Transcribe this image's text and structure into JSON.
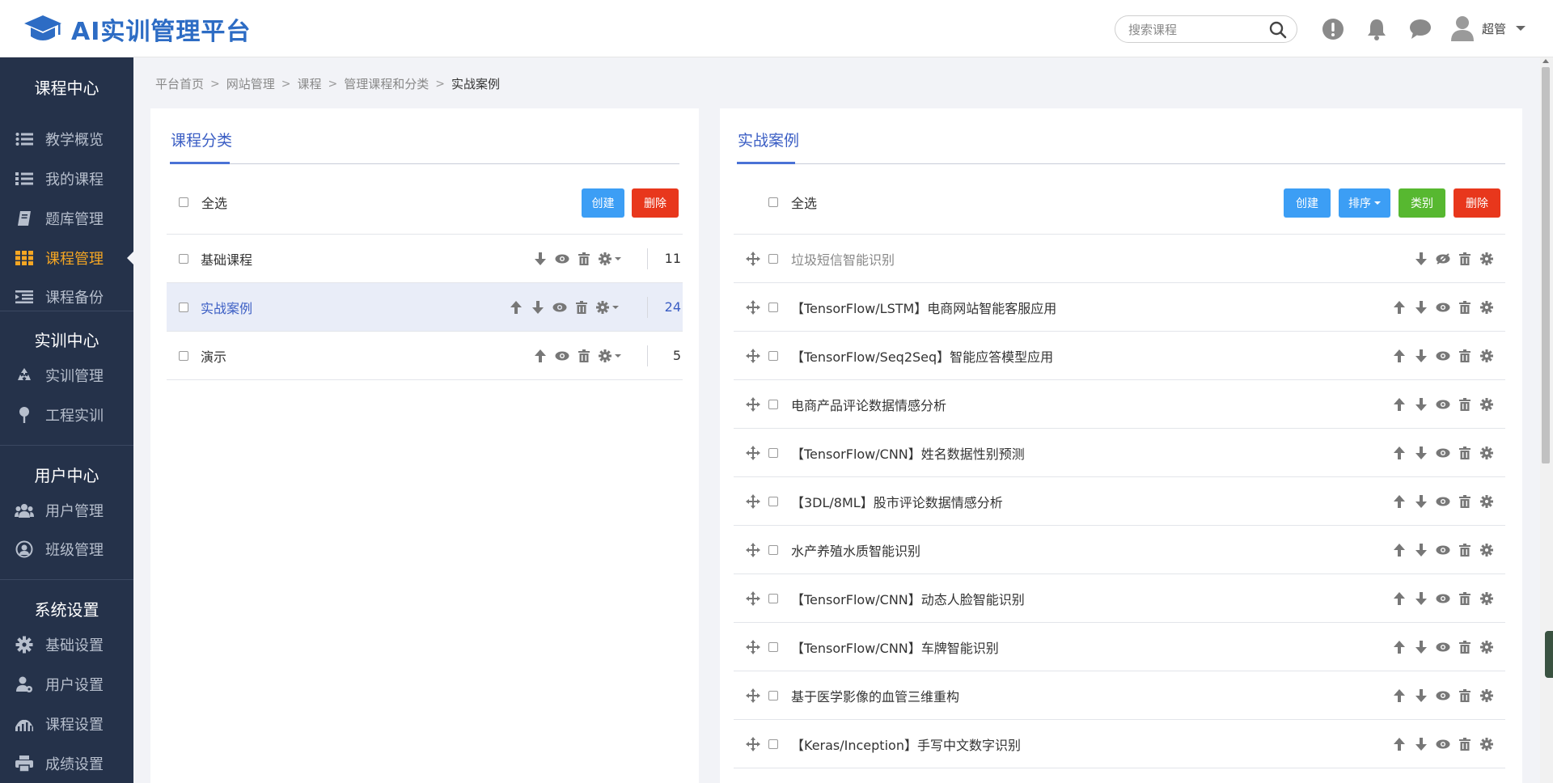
{
  "app": {
    "title": "AI实训管理平台"
  },
  "header": {
    "search_placeholder": "搜索课程",
    "user_name": "超管"
  },
  "sidebar": {
    "sections": [
      {
        "title": "课程中心",
        "items": [
          {
            "label": "教学概览",
            "icon": "list-icon"
          },
          {
            "label": "我的课程",
            "icon": "numbered-list-icon"
          },
          {
            "label": "题库管理",
            "icon": "book-icon"
          },
          {
            "label": "课程管理",
            "icon": "grid-icon",
            "active": true
          },
          {
            "label": "课程备份",
            "icon": "indent-icon"
          }
        ]
      },
      {
        "title": "实训中心",
        "items": [
          {
            "label": "实训管理",
            "icon": "recycle-icon"
          },
          {
            "label": "工程实训",
            "icon": "pin-icon"
          }
        ]
      },
      {
        "title": "用户中心",
        "items": [
          {
            "label": "用户管理",
            "icon": "users-icon"
          },
          {
            "label": "班级管理",
            "icon": "user-circle-icon"
          }
        ]
      },
      {
        "title": "系统设置",
        "items": [
          {
            "label": "基础设置",
            "icon": "gear-icon"
          },
          {
            "label": "用户设置",
            "icon": "user-gear-icon"
          },
          {
            "label": "课程设置",
            "icon": "chart-icon"
          },
          {
            "label": "成绩设置",
            "icon": "print-icon"
          }
        ]
      }
    ]
  },
  "breadcrumb": [
    "平台首页",
    "网站管理",
    "课程",
    "管理课程和分类",
    "实战案例"
  ],
  "left_panel": {
    "tab": "课程分类",
    "select_all": "全选",
    "create": "创建",
    "delete": "删除",
    "rows": [
      {
        "name": "基础课程",
        "count": "11"
      },
      {
        "name": "实战案例",
        "count": "24"
      },
      {
        "name": "演示",
        "count": "5"
      }
    ]
  },
  "right_panel": {
    "tab": "实战案例",
    "select_all": "全选",
    "create": "创建",
    "sort": "排序",
    "category": "类别",
    "delete": "删除",
    "rows": [
      {
        "name": "垃圾短信智能识别"
      },
      {
        "name": "【TensorFlow/LSTM】电商网站智能客服应用"
      },
      {
        "name": "【TensorFlow/Seq2Seq】智能应答模型应用"
      },
      {
        "name": "电商产品评论数据情感分析"
      },
      {
        "name": "【TensorFlow/CNN】姓名数据性别预测"
      },
      {
        "name": "【3DL/8ML】股市评论数据情感分析"
      },
      {
        "name": "水产养殖水质智能识别"
      },
      {
        "name": "【TensorFlow/CNN】动态人脸智能识别"
      },
      {
        "name": "【TensorFlow/CNN】车牌智能识别"
      },
      {
        "name": "基于医学影像的血管三维重构"
      },
      {
        "name": "【Keras/Inception】手写中文数字识别"
      }
    ]
  },
  "colors": {
    "brand": "#2d6cc4",
    "sidebar_bg": "#25324a",
    "active": "#f5a623",
    "primary": "#3c9ef5",
    "danger": "#e8371c",
    "success": "#57b830"
  }
}
